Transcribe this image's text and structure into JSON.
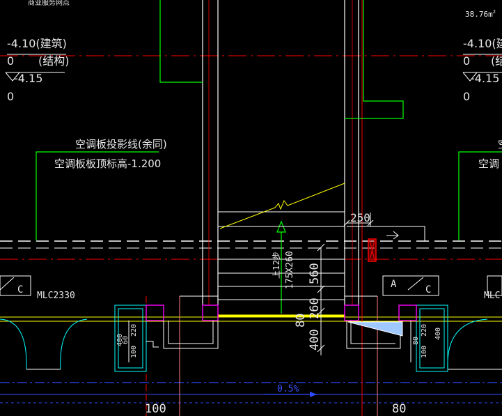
{
  "texts": {
    "top_left_cut": "商业服务网点",
    "area_right": "38.76m",
    "area_sup": "2",
    "elev_arch_l": "-4.10(建筑)",
    "elev_zero_l1": "0",
    "elev_struct_l": "(结构)",
    "elev_415_l": "-4.15",
    "elev_zero_l2": "0",
    "elev_arch_r": "-4.10(建",
    "elev_zero_r1": "0",
    "elev_struct_r": "(结",
    "elev_415_r": "-4.15",
    "elev_zero_r2": "0",
    "ac_proj_l": "空调板投影线(余同)",
    "ac_top_l": "空调板板顶标高-1.200",
    "ac_proj_r": "空",
    "ac_top_r": "空调",
    "up_steps": "上12步",
    "step_size": "175X260",
    "dim_560": "560",
    "dim_260": "260",
    "dim_400": "400",
    "dim_80_mid": "80",
    "dim_250": "250",
    "win_l": "MLC2330",
    "win_r": "MLC",
    "axis_c_l": "C",
    "axis_a_r": "A",
    "axis_c_r": "C",
    "dim_220_l": "220",
    "dim_60_l": "60",
    "dim_400_l": "400",
    "dim_100_l": "100",
    "dim_220_r": "220",
    "dim_80_r": "80",
    "dim_400_r": "400",
    "dim_100_r": "100",
    "slope": "0.5%",
    "bottom_100": "100",
    "bottom_80": "80"
  },
  "colors": {
    "background": "#000000",
    "wall": "#ffffff",
    "green": "#00ff00",
    "yellow": "#ffff00",
    "red": "#ff0000",
    "magenta": "#ff00ff",
    "cyan": "#00ffff",
    "blue": "#2f4bff",
    "dim_text": "#e8e8e8"
  }
}
